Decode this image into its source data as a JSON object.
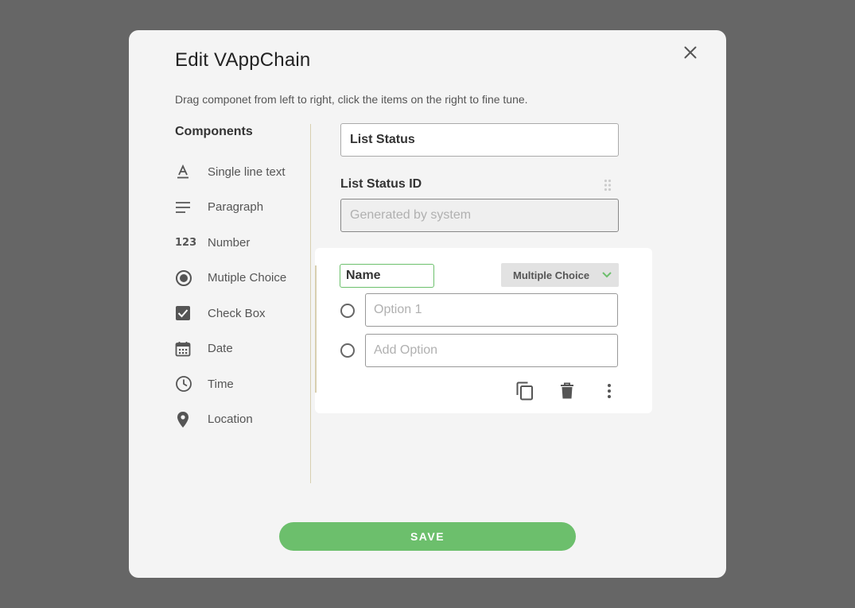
{
  "modal": {
    "title": "Edit VAppChain",
    "subtitle": "Drag componet from left to right, click the items on the right to fine tune.",
    "close_icon": "close-icon"
  },
  "components": {
    "title": "Components",
    "items": [
      {
        "label": "Single line text",
        "icon": "text-format-icon"
      },
      {
        "label": "Paragraph",
        "icon": "paragraph-icon"
      },
      {
        "label": "Number",
        "icon": "number-icon",
        "glyph": "123"
      },
      {
        "label": "Mutiple Choice",
        "icon": "radio-button-icon"
      },
      {
        "label": "Check Box",
        "icon": "checkbox-icon"
      },
      {
        "label": "Date",
        "icon": "calendar-icon"
      },
      {
        "label": "Time",
        "icon": "clock-icon"
      },
      {
        "label": "Location",
        "icon": "location-pin-icon"
      }
    ]
  },
  "form": {
    "list_name_value": "List Status",
    "id_field_label": "List Status ID",
    "id_field_placeholder": "Generated by system",
    "question": {
      "name_value": "Name",
      "type_selected": "Multiple Choice",
      "options": [
        {
          "placeholder": "Option 1"
        },
        {
          "placeholder": "Add Option"
        }
      ]
    }
  },
  "actions": {
    "save_label": "SAVE"
  },
  "colors": {
    "overlay": "#666666",
    "modal_bg": "#f4f4f4",
    "accent_green": "#6cbf6c",
    "divider": "#d8cfb0",
    "icon_gray": "#555555"
  }
}
